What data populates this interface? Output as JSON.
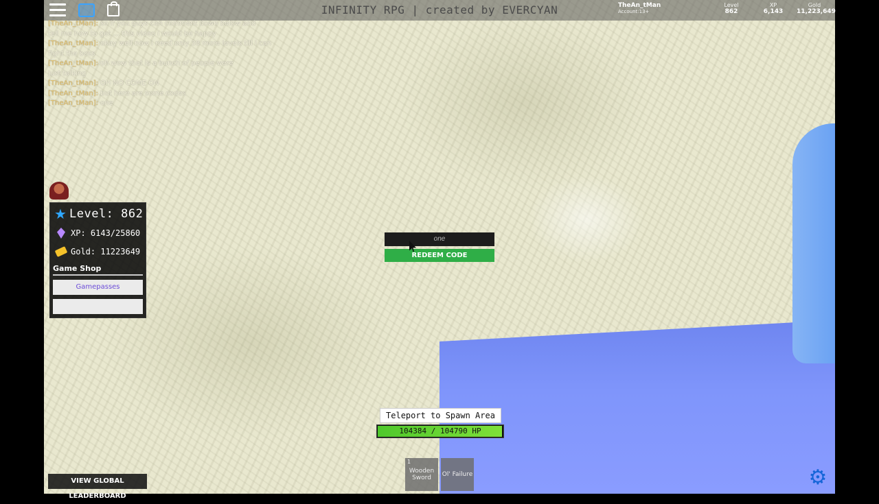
{
  "topbar": {
    "title": "INFINITY RPG | created by EVERCYAN",
    "account_name": "TheAn_tMan",
    "account_type": "Account:13+",
    "level_label": "Level",
    "level_value": "862",
    "xp_label": "XP",
    "xp_value": "6,143",
    "gold_label": "Gold",
    "gold_value": "11,223,649"
  },
  "chat": [
    {
      "who": "[TheAn_tMan]:",
      "msg": "so if you guys can comment down below and"
    },
    {
      "who": "",
      "msg": "tell me how to get ... this video i would be happy"
    },
    {
      "who": "[TheAn_tMan]:",
      "msg": "okay well now i need only 38 more levels till i can"
    },
    {
      "who": "",
      "msg": "fight the boss"
    },
    {
      "who": "[TheAn_tMan]:",
      "msg": "oh wow that is a bunch of people were"
    },
    {
      "who": "",
      "msg": "just talking"
    },
    {
      "who": "[TheAn_tMan]:",
      "msg": "OH NO COME ON"
    },
    {
      "who": "[TheAn_tMan]:",
      "msg": "but here are some codes"
    },
    {
      "who": "[TheAn_tMan]:",
      "msg": "one"
    }
  ],
  "stats": {
    "level": "Level: 862",
    "xp": "XP: 6143/25860",
    "gold": "Gold: 11223649",
    "shop_title": "Game Shop",
    "shop_btn1": "Gamepasses",
    "shop_btn2": ""
  },
  "redeem": {
    "input_value": "one",
    "button_label": "REDEEM CODE"
  },
  "teleport": {
    "label": "Teleport to Spawn Area"
  },
  "hp": {
    "text": "104384 / 104790 HP",
    "fraction": 0.996
  },
  "hotbar": [
    {
      "num": "1",
      "name": "Wooden Sword"
    },
    {
      "num": "",
      "name": "Ol' Failure"
    }
  ],
  "leaderboard": {
    "label": "VIEW GLOBAL LEADERBOARD"
  },
  "colors": {
    "accent": "#2fae47",
    "water": "#7f95fb",
    "gear": "#1565d8"
  }
}
